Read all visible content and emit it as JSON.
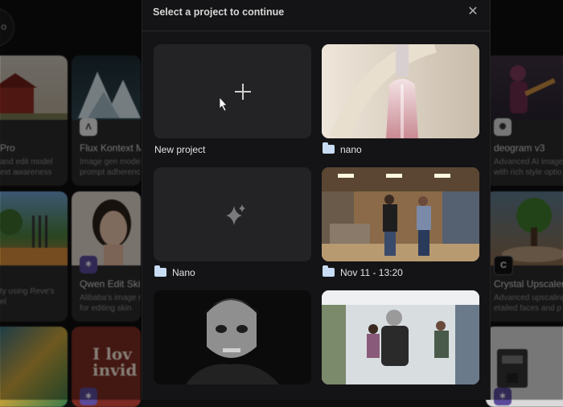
{
  "background": {
    "circle_text": "o",
    "cards": [
      {
        "title": "Pro",
        "desc": "and edit model\next awareness",
        "logo": ""
      },
      {
        "title": "Flux Kontext M",
        "desc": "Image gen model\nprompt adherenc",
        "logo": "Λ"
      },
      {
        "title": "deogram v3",
        "desc": "Advanced AI image g\nwith rich style optio",
        "logo": "✺"
      },
      {
        "title": "",
        "desc": "ty using Reve's\nel",
        "logo": ""
      },
      {
        "title": "Qwen Edit Skin",
        "desc": "Alibaba's image m\nfor editing skin",
        "logo": "✶"
      },
      {
        "title": "Crystal Upscaler",
        "desc": "Advanced upscaling\netailed faces and p",
        "logo": "C"
      },
      {
        "title": "",
        "desc": "",
        "logo": ""
      },
      {
        "title": "",
        "desc": "",
        "logo": ""
      },
      {
        "title": "",
        "desc": "",
        "logo": ""
      }
    ],
    "tshirt_text": "I lov\ninvid"
  },
  "modal": {
    "title": "Select a project to continue",
    "close_icon": "close-icon",
    "new_project": {
      "label": "New project",
      "icon": "plus-icon"
    },
    "projects": [
      {
        "label": "nano",
        "icon": "folder-icon",
        "kind": "bottle"
      },
      {
        "label": "Nano",
        "icon": "folder-icon",
        "kind": "sparkle"
      },
      {
        "label": "Nov 11 - 13:20",
        "icon": "folder-icon",
        "kind": "store"
      },
      {
        "label": "",
        "icon": "",
        "kind": "zombie"
      },
      {
        "label": "",
        "icon": "",
        "kind": "zombie-store"
      }
    ]
  },
  "colors": {
    "modal_bg": "#141416",
    "tile_bg": "#232325",
    "folder": "#c8ddf3"
  }
}
